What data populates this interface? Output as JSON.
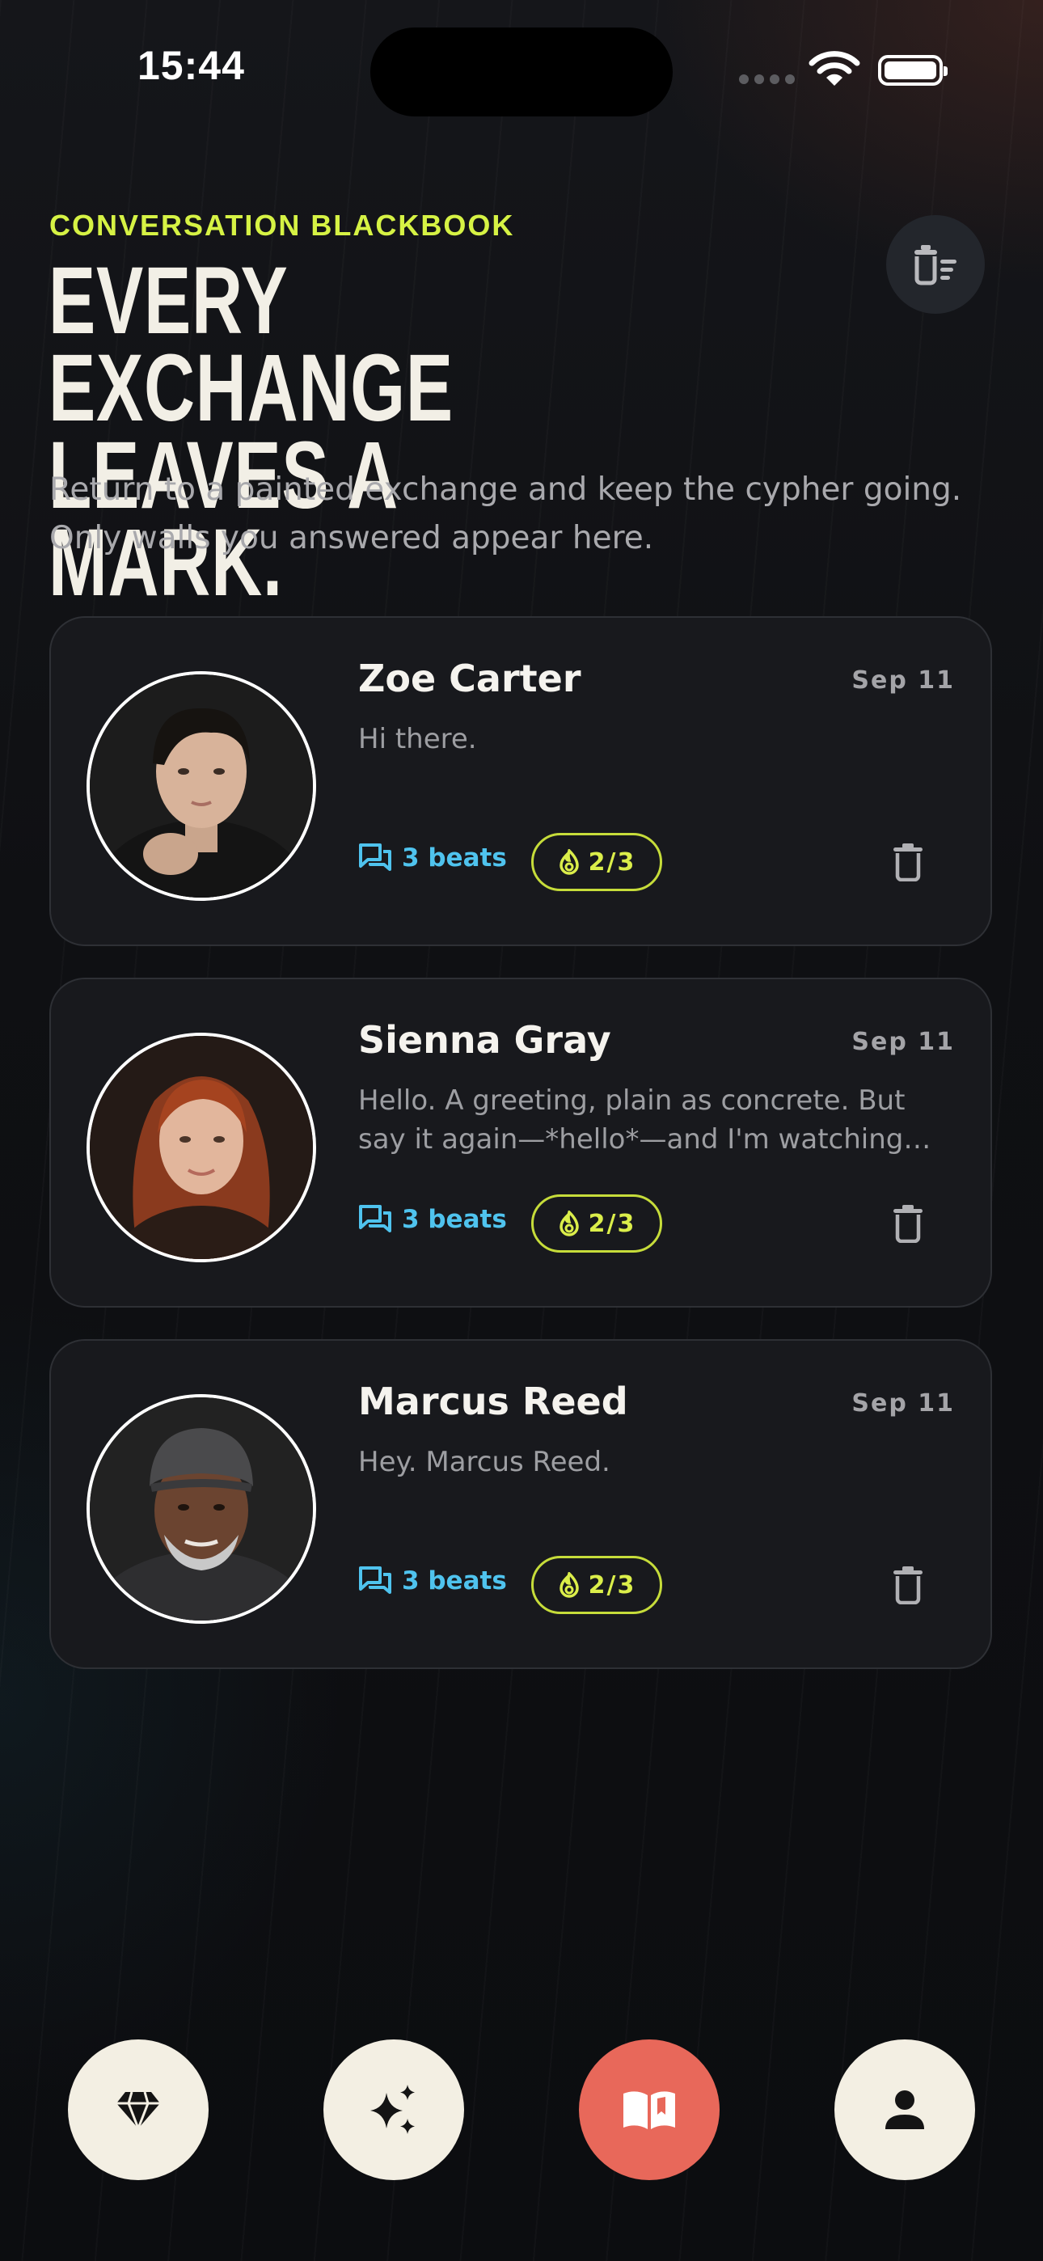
{
  "status_bar": {
    "time": "15:44"
  },
  "header": {
    "eyebrow": "CONVERSATION BLACKBOOK",
    "headline_line1": "EVERY EXCHANGE",
    "headline_line2": "LEAVES A MARK.",
    "subtitle": "Return to a painted exchange and keep the cypher going. Only walls you answered appear here.",
    "clear_icon": "clear-list-icon"
  },
  "conversations": [
    {
      "name": "Zoe Carter",
      "date": "Sep 11",
      "preview": "Hi there.",
      "beats": "3 beats",
      "streak": "2/3"
    },
    {
      "name": "Sienna Gray",
      "date": "Sep 11",
      "preview": "Hello. A greeting, plain as concrete. But say it again—*hello*—and I'm watching how the word lands.",
      "beats": "3 beats",
      "streak": "2/3"
    },
    {
      "name": "Marcus Reed",
      "date": "Sep 11",
      "preview": "Hey. Marcus Reed.",
      "beats": "3 beats",
      "streak": "2/3"
    }
  ],
  "nav": {
    "items": [
      "diamond-icon",
      "sparkles-icon",
      "open-book-icon",
      "person-icon"
    ],
    "active": "open-book-icon"
  },
  "colors": {
    "accent_lime": "#d6f244",
    "beats_blue": "#4fc3ee",
    "active_nav": "#e8685a",
    "nav_bg": "#f3efe3"
  }
}
